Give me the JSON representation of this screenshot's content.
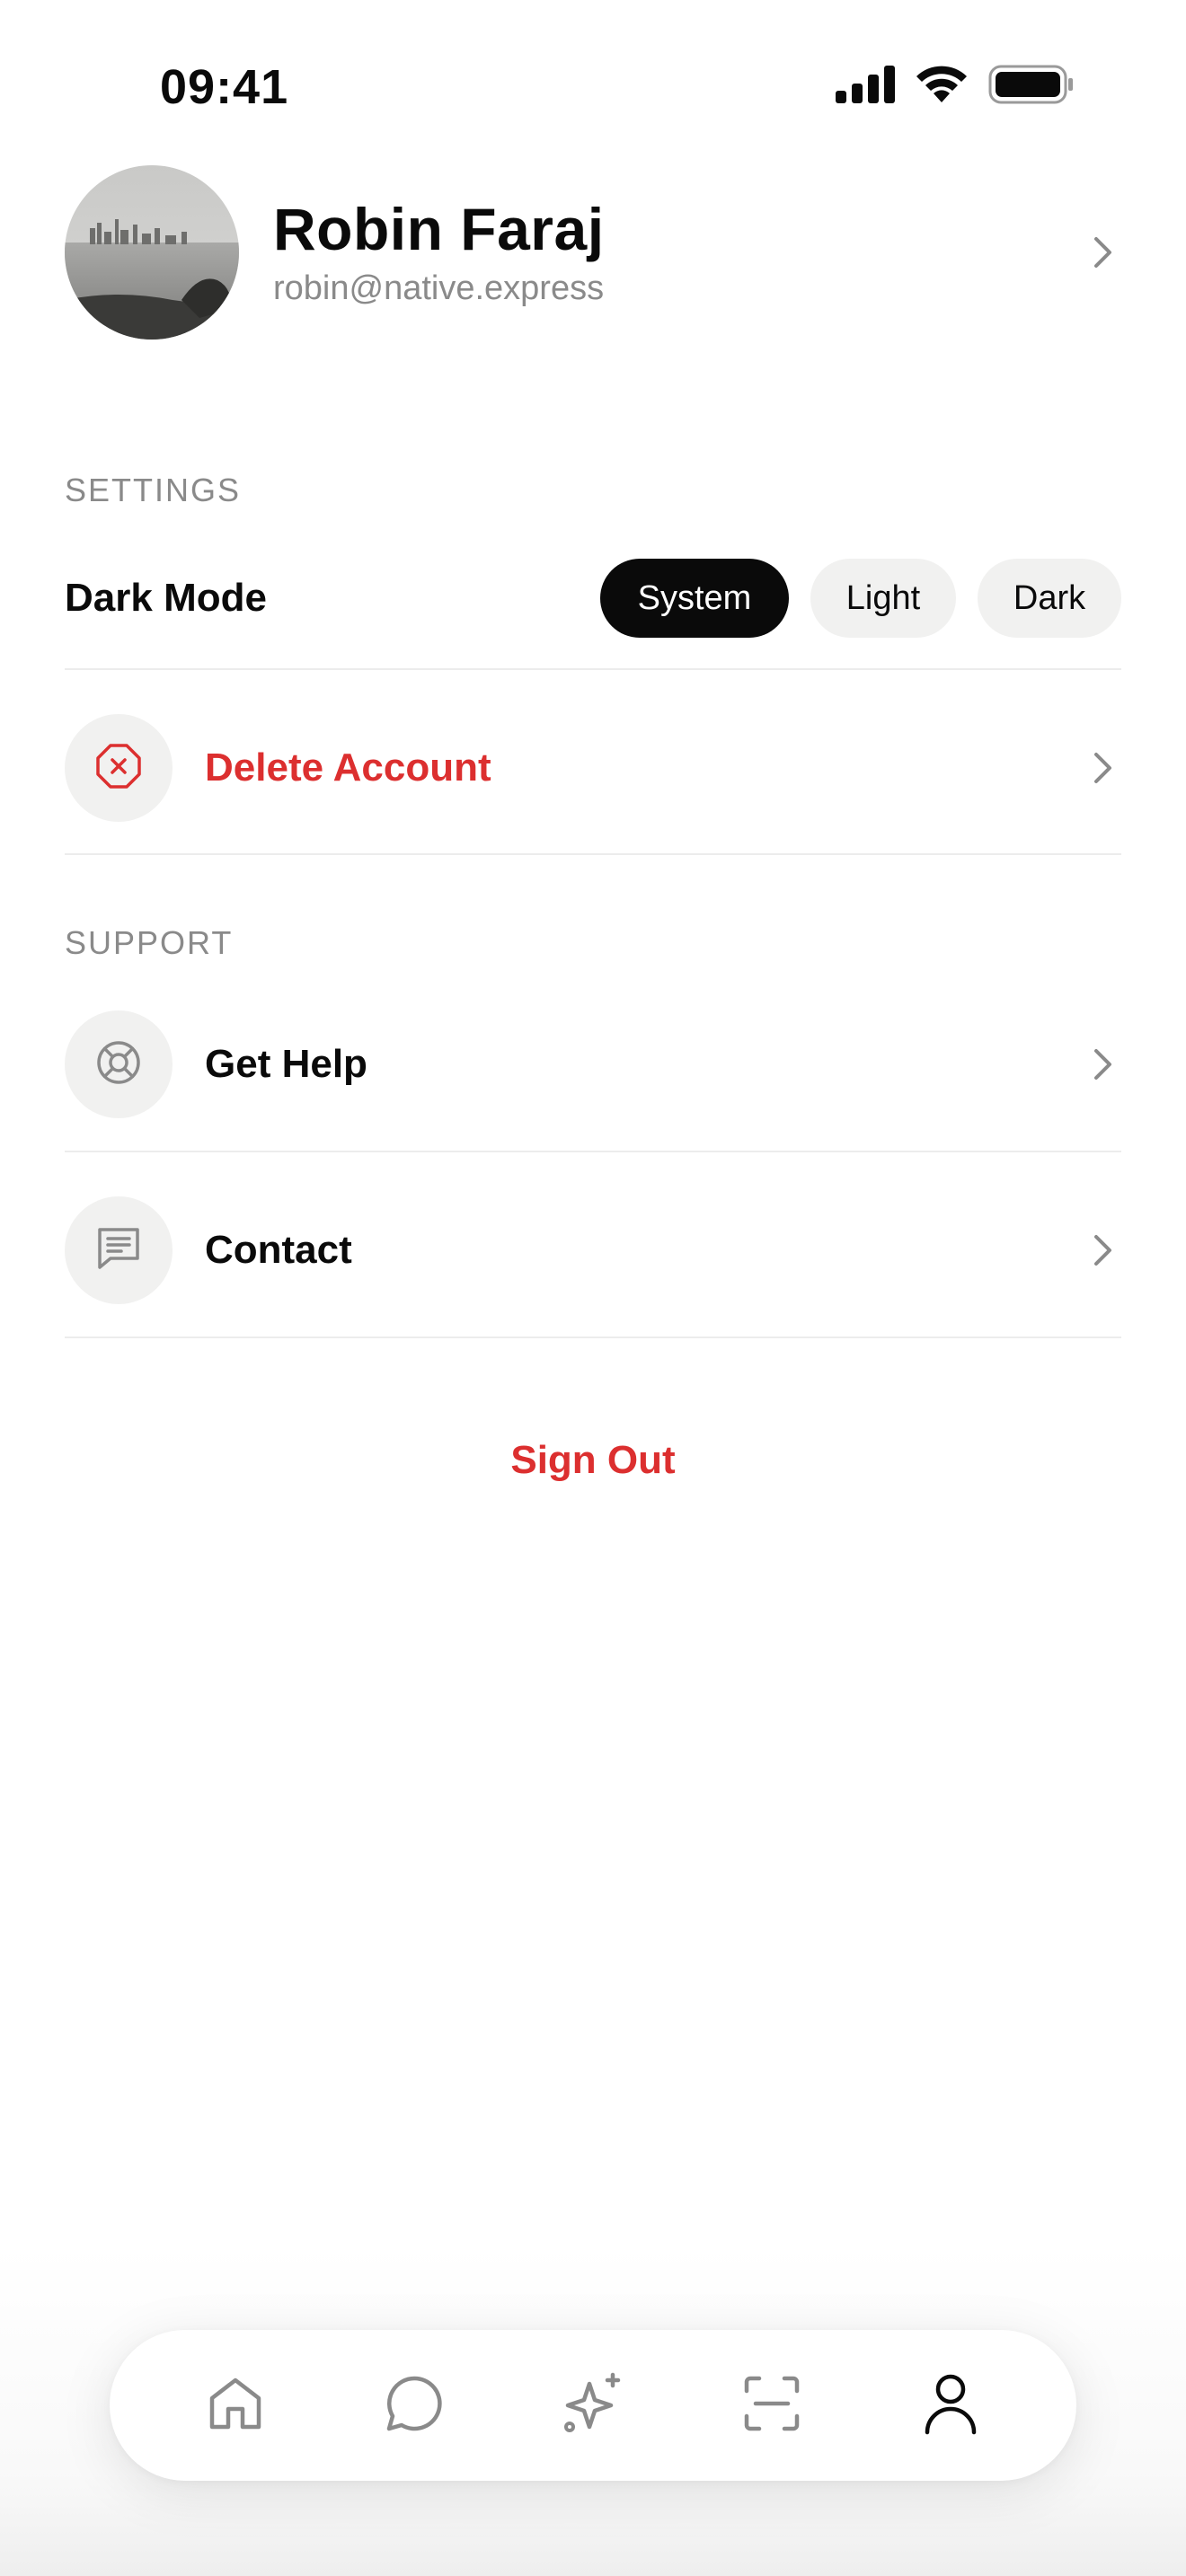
{
  "status_bar": {
    "time": "09:41"
  },
  "profile": {
    "name": "Robin Faraj",
    "email": "robin@native.express"
  },
  "settings": {
    "section_title": "SETTINGS",
    "dark_mode_label": "Dark Mode",
    "dark_mode_options": [
      "System",
      "Light",
      "Dark"
    ],
    "dark_mode_selected": "System",
    "delete_account_label": "Delete Account"
  },
  "support": {
    "section_title": "SUPPORT",
    "get_help_label": "Get Help",
    "contact_label": "Contact"
  },
  "sign_out_label": "Sign Out",
  "tabbar": {
    "tabs": [
      {
        "icon": "home-icon",
        "active": false
      },
      {
        "icon": "chat-icon",
        "active": false
      },
      {
        "icon": "sparkles-icon",
        "active": false
      },
      {
        "icon": "scan-icon",
        "active": false
      },
      {
        "icon": "user-icon",
        "active": true
      }
    ]
  },
  "colors": {
    "danger": "#dc2f2f",
    "muted_text": "#8a8a8a",
    "chip_bg": "#f1f1f0",
    "active_chip": "#0a0a0a"
  }
}
